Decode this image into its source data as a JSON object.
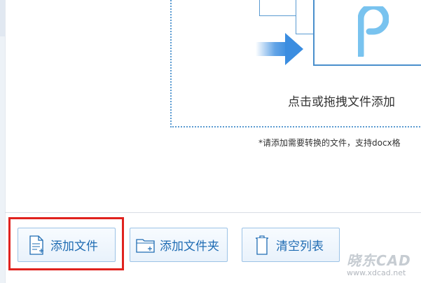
{
  "drop_zone": {
    "hint": "点击或拖拽文件添加"
  },
  "note": "*请添加需要转换的文件，支持docx格",
  "toolbar": {
    "add_file_label": "添加文件",
    "add_folder_label": "添加文件夹",
    "clear_list_label": "清空列表"
  },
  "watermark": {
    "title": "晓东CAD",
    "url": "www.xdcad.net"
  },
  "colors": {
    "accent": "#1f6cb3",
    "border": "#9cc3e6",
    "highlight": "#e0221e",
    "logo": "#79c3ef"
  }
}
